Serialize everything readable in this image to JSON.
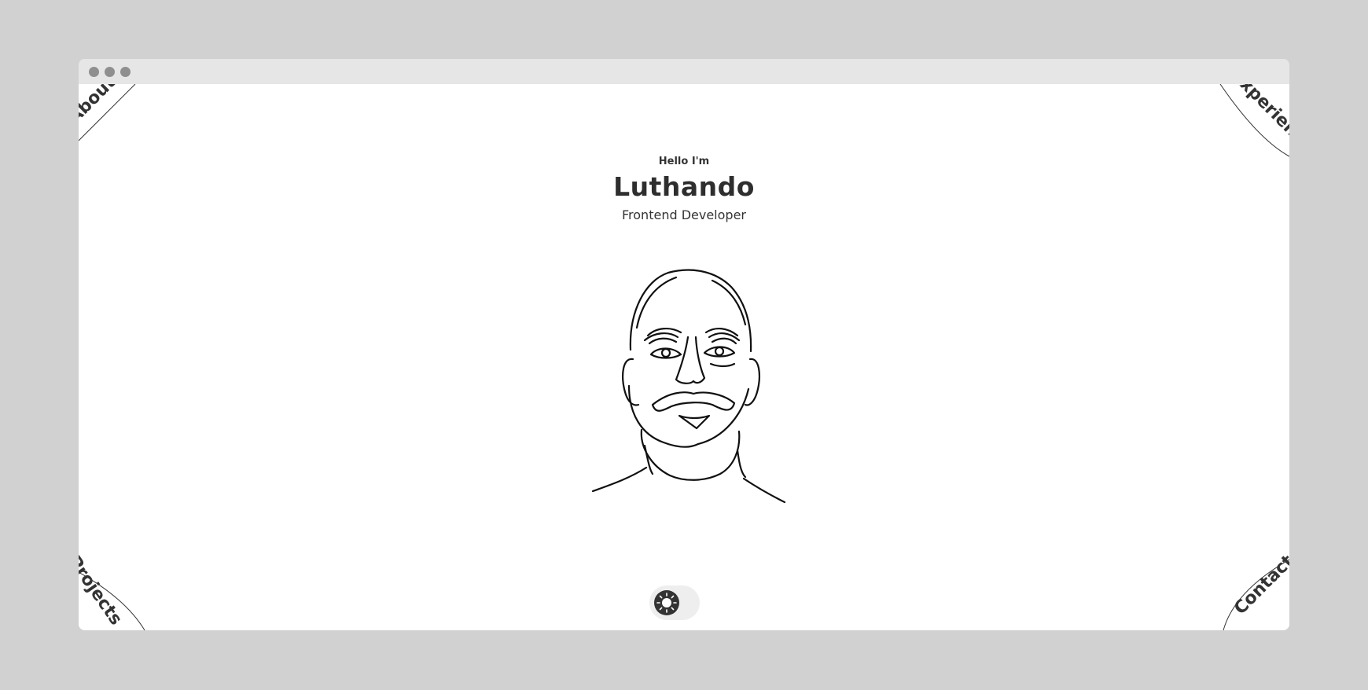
{
  "hero": {
    "greeting": "Hello I'm",
    "name": "Luthando",
    "role": "Frontend Developer"
  },
  "nav": {
    "about": "About",
    "experience": "Experience",
    "projects": "Projects",
    "contact": "Contact"
  },
  "theme_toggle": {
    "icon": "sun-icon",
    "state": "light"
  },
  "colors": {
    "background": "#ffffff",
    "text": "#2e2e2e",
    "chrome": "#e6e6e6",
    "outer": "#d1d1d1"
  }
}
